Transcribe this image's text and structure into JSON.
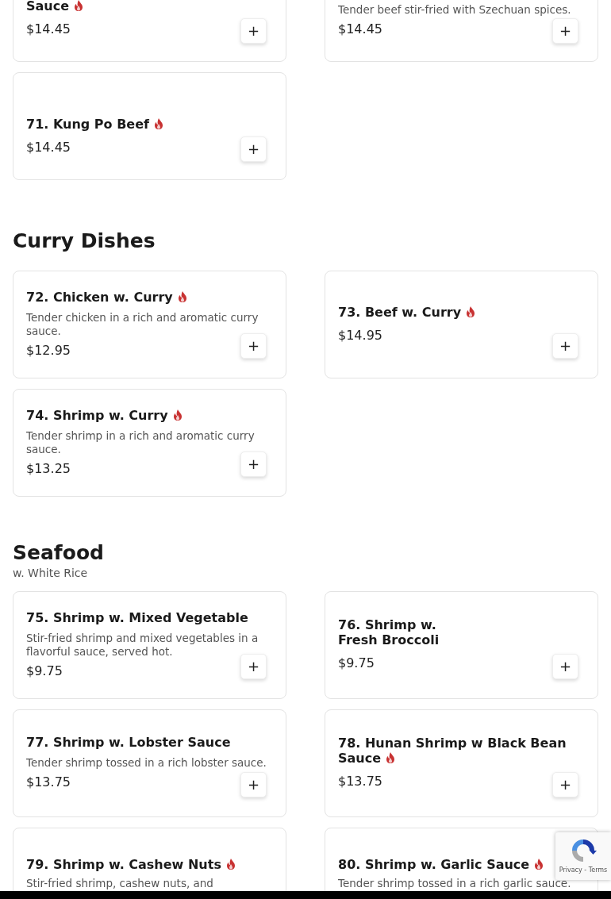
{
  "sections": [
    {
      "items": [
        {
          "name": "Sauce",
          "spicy": true,
          "price": "$14.45"
        },
        {
          "description": "Tender beef stir-fried with Szechuan spices.",
          "price": "$14.45"
        },
        {
          "name": "71. Kung Po Beef",
          "spicy": true,
          "price": "$14.45"
        }
      ]
    },
    {
      "title": "Curry Dishes",
      "items": [
        {
          "name": "72. Chicken w. Curry",
          "spicy": true,
          "description": "Tender chicken in a rich and aromatic curry sauce.",
          "price": "$12.95"
        },
        {
          "name": "73. Beef w. Curry",
          "spicy": true,
          "price": "$14.95"
        },
        {
          "name": "74. Shrimp w. Curry",
          "spicy": true,
          "description": "Tender shrimp in a rich and aromatic curry sauce.",
          "price": "$13.25"
        }
      ]
    },
    {
      "title": "Seafood",
      "subtitle": "w. White Rice",
      "items": [
        {
          "name": "75. Shrimp w. Mixed Vegetable",
          "spicy": false,
          "description": "Stir-fried shrimp and mixed vegetables in a flavorful sauce, served hot.",
          "price": "$9.75"
        },
        {
          "name": "76. Shrimp w.\nFresh Broccoli",
          "spicy": false,
          "price": "$9.75"
        },
        {
          "name": "77. Shrimp w. Lobster Sauce",
          "spicy": false,
          "description": "Tender shrimp tossed in a rich lobster sauce.",
          "price": "$13.75"
        },
        {
          "name": "78. Hunan Shrimp w Black Bean Sauce",
          "spicy": true,
          "price": "$13.75"
        },
        {
          "name": "79. Shrimp w. Cashew Nuts",
          "spicy": true,
          "description": "Stir-fried shrimp, cashew nuts, and"
        },
        {
          "name": "80. Shrimp w. Garlic Sauce",
          "spicy": true,
          "description": "Tender shrimp tossed in a rich garlic sauce."
        }
      ]
    }
  ],
  "add_button": {
    "label": "+"
  },
  "recaptcha": {
    "links": "Privacy - Terms"
  }
}
